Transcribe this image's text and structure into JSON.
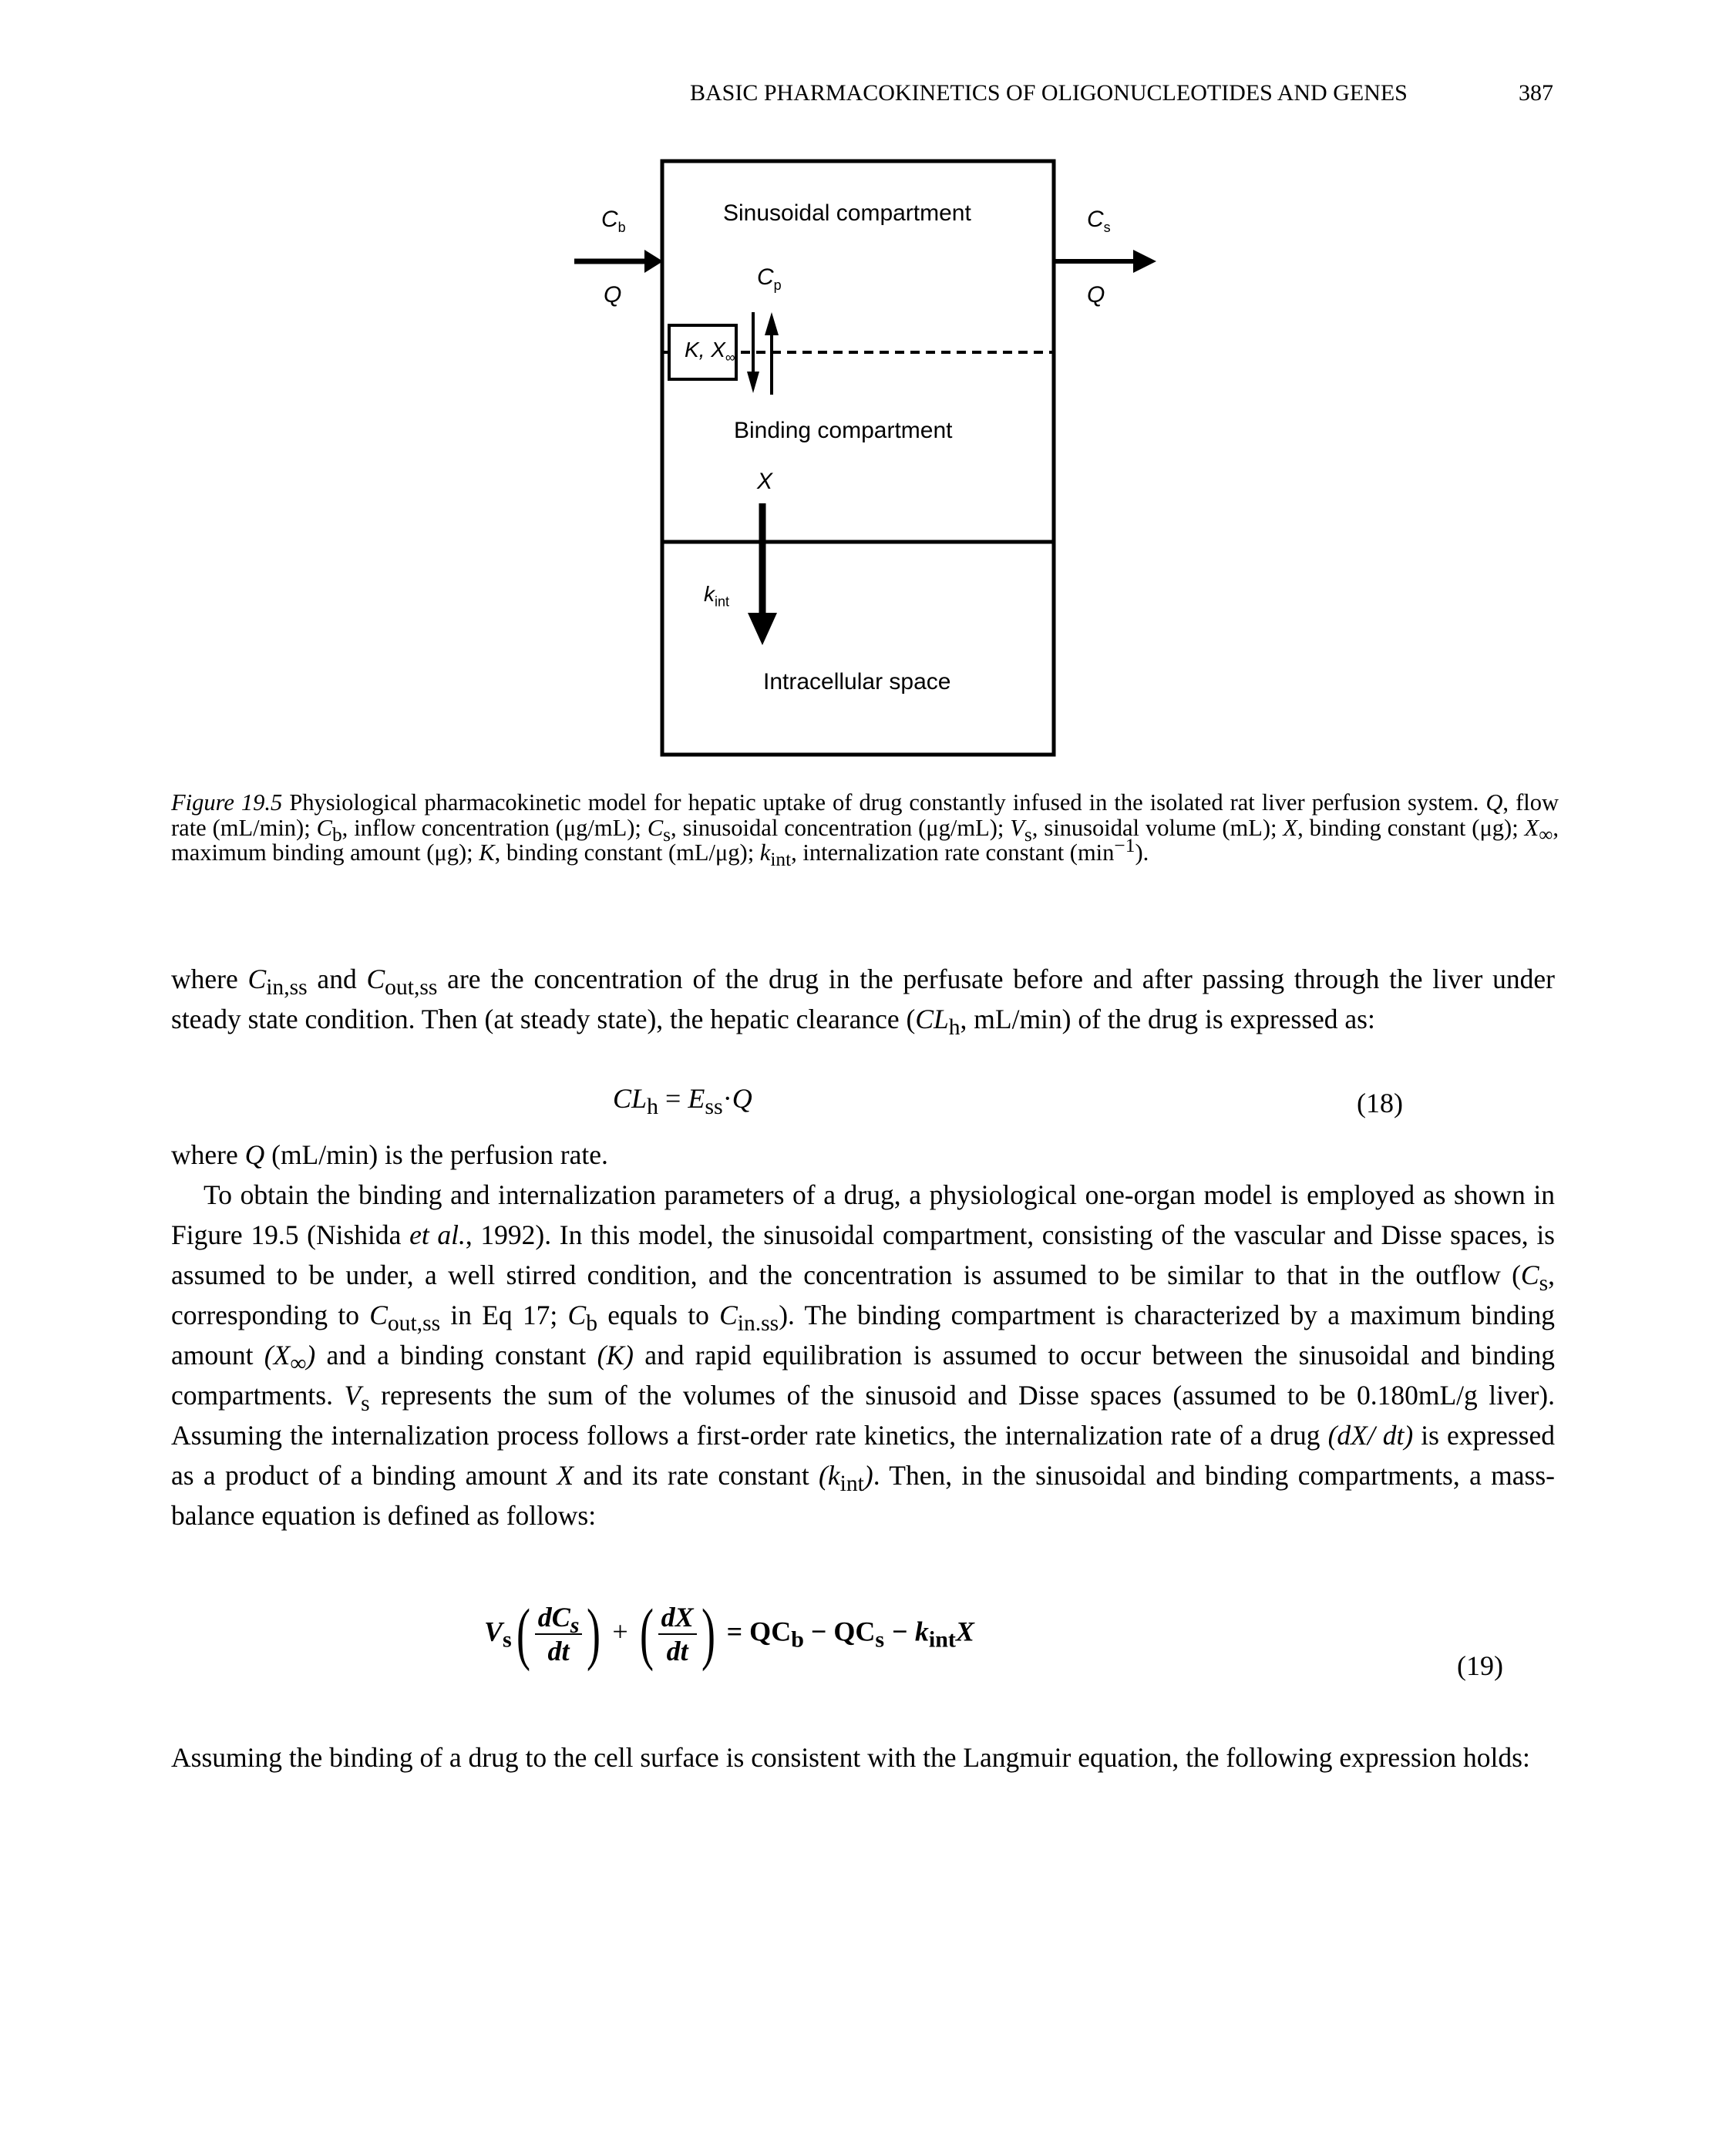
{
  "running_head": {
    "title": "BASIC PHARMACOKINETICS OF OLIGONUCLEOTIDES AND GENES",
    "page_number": "387"
  },
  "figure": {
    "sinusoidal_label": "Sinusoidal compartment",
    "binding_label": "Binding compartment",
    "intracellular_label": "Intracellular space",
    "inflow_conc": "C",
    "inflow_conc_sub": "b",
    "inflow_rate": "Q",
    "outflow_conc": "C",
    "outflow_conc_sub": "s",
    "outflow_rate": "Q",
    "plasma_conc": "C",
    "plasma_conc_sub": "p",
    "binding_params": "K, X",
    "binding_params_sub": "∞",
    "binding_amount": "X",
    "internalization_const": "k",
    "internalization_const_sub": "int"
  },
  "caption": {
    "label": "Figure 19.5",
    "text_1": " Physiological pharmacokinetic model for hepatic uptake of drug constantly infused in the isolated rat liver perfusion system. ",
    "q": "Q",
    "text_2": ", flow rate (mL/min); ",
    "cb": "C",
    "cb_sub": "b",
    "text_3": ", inflow concentration (μg/mL); ",
    "cs": "C",
    "cs_sub": "s",
    "text_4": ", sinusoidal concentration (μg/mL); ",
    "vs": "V",
    "vs_sub": "s",
    "text_5": ", sinusoidal volume (mL); ",
    "x": "X",
    "text_6": ", binding constant (μg); ",
    "xinf": "X",
    "xinf_sub": "∞",
    "text_7": ", maximum binding amount (μg); ",
    "k": "K",
    "text_8": ", binding constant (mL/μg); ",
    "kint": "k",
    "kint_sub": "int",
    "text_9": ", internalization rate constant (min",
    "text_9_sup": "−1",
    "text_10": ")."
  },
  "body": {
    "p1_a": "where ",
    "p1_cin": "C",
    "p1_cin_sub": "in,ss",
    "p1_b": " and ",
    "p1_cout": "C",
    "p1_cout_sub": "out,ss",
    "p1_c": " are the concentration of the drug in the perfusate before and after passing through the liver under steady state condition. Then (at steady state), the hepatic clearance (",
    "p1_cl": "CL",
    "p1_cl_sub": "h",
    "p1_d": ", mL/min) of the drug is expressed as:",
    "eq18_lhs": "CL",
    "eq18_lhs_sub": "h",
    "eq18_eq": " = ",
    "eq18_e": "E",
    "eq18_e_sub": "ss",
    "eq18_dot": "·",
    "eq18_q": "Q",
    "eq18_num": "(18)",
    "p2_a": "where ",
    "p2_q": "Q",
    "p2_b": " (mL/min) is the perfusion rate.",
    "p3_a": "To obtain the binding and internalization parameters of a drug, a physiological one-organ model is employed as shown in Figure 19.5 (Nishida ",
    "p3_etal": "et al.",
    "p3_b": ", 1992). In this model, the sinusoidal compartment, consisting of the vascular and Disse spaces, is assumed to be under, a well stirred condition, and the concentration is assumed to be similar to that in the outflow (",
    "p3_cs": "C",
    "p3_cs_sub": "s",
    "p3_c": ", corresponding to ",
    "p3_cout": "C",
    "p3_cout_sub": "out,ss",
    "p3_d": " in Eq 17; ",
    "p3_cb": "C",
    "p3_cb_sub": "b",
    "p3_e": " equals to ",
    "p3_cin": "C",
    "p3_cin_sub": "in.ss",
    "p3_f": "). The binding compartment is characterized by a maximum binding amount ",
    "p3_xinf": "(X",
    "p3_xinf_sub": "∞",
    "p3_xinf_close": ")",
    "p3_g": " and a binding constant ",
    "p3_k": "(K)",
    "p3_h": " and rapid equilibration is assumed to occur between the sinusoidal and binding compartments. ",
    "p3_vs": "V",
    "p3_vs_sub": "s",
    "p3_i": " represents the sum of the volumes of the sinusoid and Disse spaces (assumed to be 0.180mL/g liver). Assuming the internalization process follows a first-order rate kinetics, the internalization rate of a drug ",
    "p3_dxdt": "(dX/ dt)",
    "p3_j": " is expressed as a product of a binding amount ",
    "p3_x": "X",
    "p3_k2": " and its rate constant ",
    "p3_kint": "(k",
    "p3_kint_sub": "int",
    "p3_kint_close": ")",
    "p3_l": ". Then, in the sinusoidal and binding compartments, a mass-balance equation is defined as follows:",
    "eq19_vs": "V",
    "eq19_vs_sub": "s",
    "eq19_num1": "dC",
    "eq19_num1_sub": "s",
    "eq19_den1": "dt",
    "eq19_plus": "+",
    "eq19_num2": "dX",
    "eq19_den2": "dt",
    "eq19_rhs": "= QC",
    "eq19_rhs_sub1": "b",
    "eq19_rhs2": " − QC",
    "eq19_rhs_sub2": "s",
    "eq19_rhs3": " − k",
    "eq19_rhs_sub3": "int",
    "eq19_rhs4": "X",
    "eq19_num": "(19)",
    "p4": "Assuming the binding of a drug to the cell surface is consistent with the Langmuir equation, the following expression holds:"
  }
}
